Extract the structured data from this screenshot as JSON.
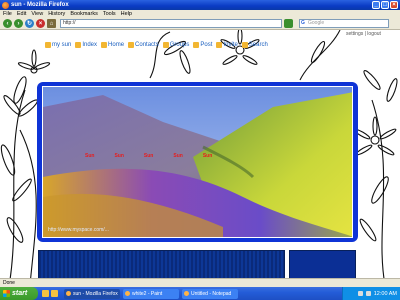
{
  "window": {
    "title": "sun - Mozilla Firefox",
    "minimize": "_",
    "maximize": "□",
    "close": "×"
  },
  "menubar": [
    "File",
    "Edit",
    "View",
    "History",
    "Bookmarks",
    "Tools",
    "Help"
  ],
  "navbar": {
    "url": "http://",
    "search_placeholder": "Google"
  },
  "site": {
    "settings_text": "settings | logout",
    "nav": [
      "my sun",
      "Index",
      "Home",
      "Contacts",
      "Groups",
      "Post",
      "Invite",
      "Search"
    ]
  },
  "banner": {
    "overlay_texts": [
      "Sun",
      "Sun",
      "Sun",
      "Sun",
      "Sun"
    ],
    "link": "http://www.myspace.com/..."
  },
  "statusbar": {
    "text": "Done"
  },
  "taskbar": {
    "start": "start",
    "tasks": [
      {
        "label": "sun - Mozilla Firefox",
        "active": true
      },
      {
        "label": "white2 - Paint",
        "active": false
      },
      {
        "label": "Untitled - Notepad",
        "active": false
      }
    ],
    "clock": "12:00 AM"
  },
  "colors": {
    "frame_blue": "#0f34d6",
    "titlebar_blue": "#0a3bc4",
    "taskbar_blue": "#245dd8"
  }
}
